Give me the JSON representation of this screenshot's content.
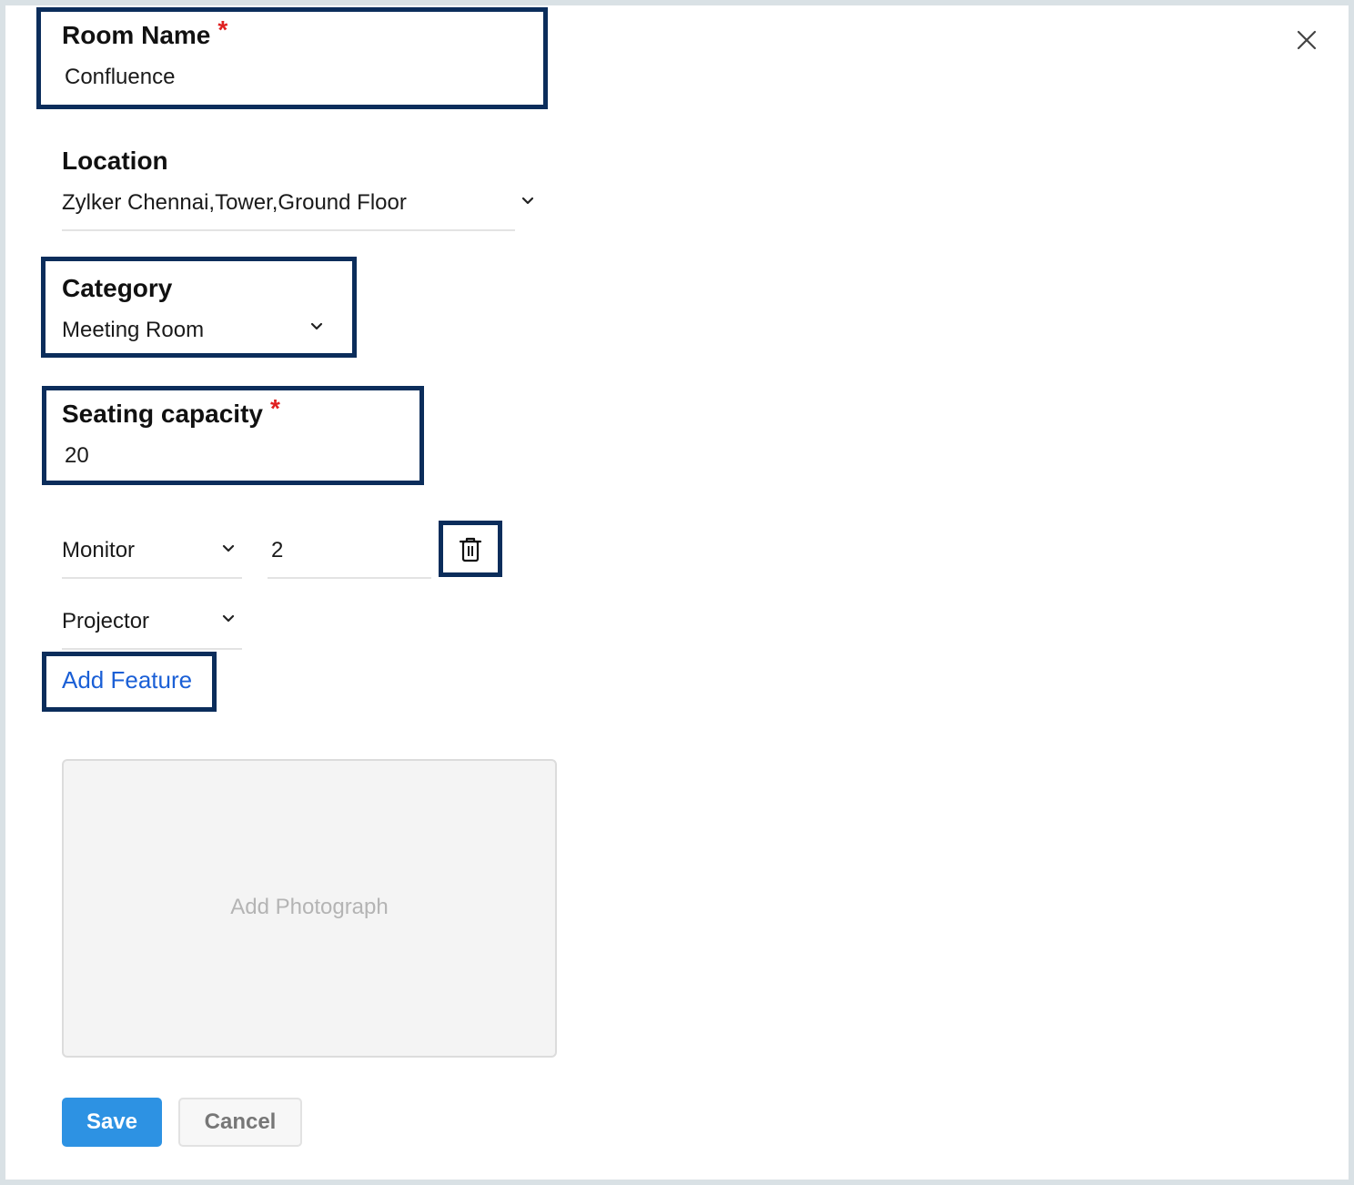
{
  "form": {
    "room_name": {
      "label": "Room Name",
      "required_mark": "*",
      "value": "Confluence"
    },
    "location": {
      "label": "Location",
      "value": "Zylker Chennai,Tower,Ground Floor"
    },
    "category": {
      "label": "Category",
      "value": "Meeting Room"
    },
    "seating_capacity": {
      "label": "Seating capacity",
      "required_mark": "*",
      "value": "20"
    },
    "features": [
      {
        "name": "Monitor",
        "quantity": "2"
      },
      {
        "name": "Projector"
      }
    ],
    "add_feature_label": "Add Feature",
    "photo_placeholder": "Add Photograph"
  },
  "actions": {
    "save_label": "Save",
    "cancel_label": "Cancel"
  },
  "icons": {
    "close": "close-icon",
    "dropdown": "chevron-down-icon",
    "delete": "trash-icon"
  },
  "colors": {
    "highlight_border": "#0b2d5b",
    "required": "#e02020",
    "link": "#1a5fd6",
    "primary_button": "#2d92e3"
  }
}
